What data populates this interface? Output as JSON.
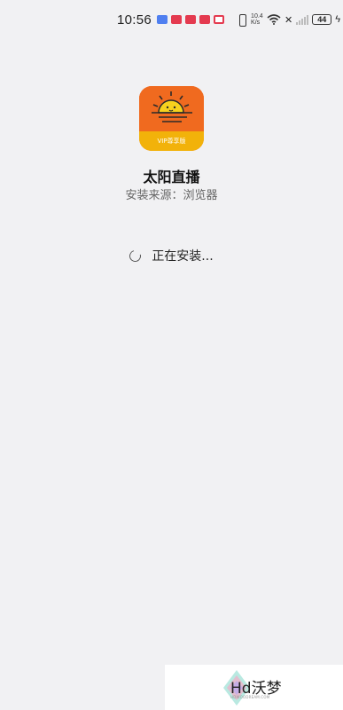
{
  "status_bar": {
    "time": "10:56",
    "net_speed_value": "10.4",
    "net_speed_unit": "K/s",
    "battery": "44"
  },
  "app": {
    "name": "太阳直播",
    "source": "安装来源：浏览器",
    "icon_badge": "VIP尊享版",
    "icon_colors": {
      "top": "#f06a1f",
      "band": "#f2b20a",
      "sun": "#f7d21e"
    }
  },
  "install": {
    "status": "正在安装..."
  },
  "watermark": {
    "text": "Hd沃梦",
    "sub": "HDWOODREAM.COM"
  }
}
